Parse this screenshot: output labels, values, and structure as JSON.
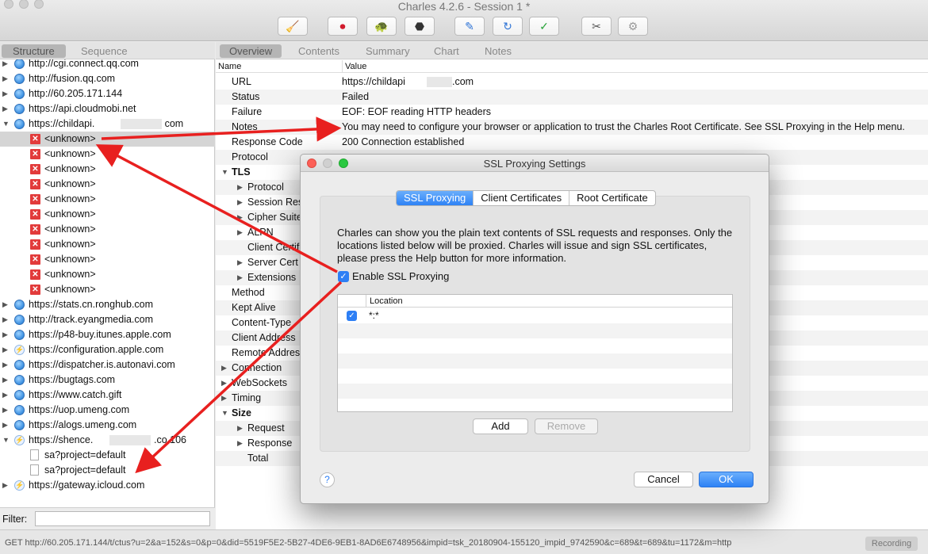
{
  "window": {
    "title": "Charles 4.2.6 - Session 1 *"
  },
  "toolbar": {
    "buttons": [
      {
        "name": "broom",
        "glyph": "🧹"
      },
      {
        "name": "record",
        "glyph": "⏺"
      },
      {
        "name": "throttle",
        "glyph": "🐢"
      },
      {
        "name": "breakpoints",
        "glyph": "⬣"
      },
      {
        "name": "compose",
        "glyph": "✎"
      },
      {
        "name": "repeat",
        "glyph": "↻"
      },
      {
        "name": "validate",
        "glyph": "✓"
      },
      {
        "name": "tools",
        "glyph": "✂"
      },
      {
        "name": "settings",
        "glyph": "⚙"
      }
    ]
  },
  "left": {
    "view_tabs": [
      "Structure",
      "Sequence"
    ],
    "tree": [
      {
        "label": "http://cgi.connect.qq.com",
        "icon": "globe",
        "indent": 0,
        "twisty": "▶"
      },
      {
        "label": "http://fusion.qq.com",
        "icon": "globe",
        "indent": 0,
        "twisty": "▶"
      },
      {
        "label": "http://60.205.171.144",
        "icon": "globe",
        "indent": 0,
        "twisty": "▶"
      },
      {
        "label": "https://api.cloudmobi.net",
        "icon": "globe",
        "indent": 0,
        "twisty": "▶"
      },
      {
        "label": "https://childapi.",
        "label2": "com",
        "icon": "globe",
        "indent": 0,
        "twisty": "▼"
      },
      {
        "label": "<unknown>",
        "icon": "error",
        "indent": 1,
        "selected": true
      },
      {
        "label": "<unknown>",
        "icon": "error",
        "indent": 1
      },
      {
        "label": "<unknown>",
        "icon": "error",
        "indent": 1
      },
      {
        "label": "<unknown>",
        "icon": "error",
        "indent": 1
      },
      {
        "label": "<unknown>",
        "icon": "error",
        "indent": 1
      },
      {
        "label": "<unknown>",
        "icon": "error",
        "indent": 1
      },
      {
        "label": "<unknown>",
        "icon": "error",
        "indent": 1
      },
      {
        "label": "<unknown>",
        "icon": "error",
        "indent": 1
      },
      {
        "label": "<unknown>",
        "icon": "error",
        "indent": 1
      },
      {
        "label": "<unknown>",
        "icon": "error",
        "indent": 1
      },
      {
        "label": "<unknown>",
        "icon": "error",
        "indent": 1
      },
      {
        "label": "https://stats.cn.ronghub.com",
        "icon": "globe",
        "indent": 0,
        "twisty": "▶"
      },
      {
        "label": "http://track.eyangmedia.com",
        "icon": "globe",
        "indent": 0,
        "twisty": "▶"
      },
      {
        "label": "https://p48-buy.itunes.apple.com",
        "icon": "globe",
        "indent": 0,
        "twisty": "▶"
      },
      {
        "label": "https://configuration.apple.com",
        "icon": "bolt",
        "indent": 0,
        "twisty": "▶"
      },
      {
        "label": "https://dispatcher.is.autonavi.com",
        "icon": "globe",
        "indent": 0,
        "twisty": "▶"
      },
      {
        "label": "https://bugtags.com",
        "icon": "globe",
        "indent": 0,
        "twisty": "▶"
      },
      {
        "label": "https://www.catch.gift",
        "icon": "globe",
        "indent": 0,
        "twisty": "▶"
      },
      {
        "label": "https://uop.umeng.com",
        "icon": "globe",
        "indent": 0,
        "twisty": "▶"
      },
      {
        "label": "https://alogs.umeng.com",
        "icon": "globe",
        "indent": 0,
        "twisty": "▶"
      },
      {
        "label": "https://shence.",
        "label2": ".co  106",
        "icon": "bolt",
        "indent": 0,
        "twisty": "▼"
      },
      {
        "label": "sa?project=default",
        "icon": "doc",
        "indent": 1
      },
      {
        "label": "sa?project=default",
        "icon": "doc",
        "indent": 1
      },
      {
        "label": "https://gateway.icloud.com",
        "icon": "bolt",
        "indent": 0,
        "twisty": "▶"
      }
    ],
    "filter_label": "Filter:"
  },
  "right": {
    "tabs": [
      "Overview",
      "Contents",
      "Summary",
      "Chart",
      "Notes"
    ],
    "col_name": "Name",
    "col_value": "Value",
    "rows": [
      {
        "name": "URL",
        "value": "https://childapi",
        "value2": ".com",
        "indent": 0
      },
      {
        "name": "Status",
        "value": "Failed",
        "indent": 0
      },
      {
        "name": "Failure",
        "value": "EOF: EOF reading HTTP headers",
        "indent": 0
      },
      {
        "name": "Notes",
        "value": "You may need to configure your browser or application to trust the Charles Root Certificate. See SSL Proxying in the Help menu.",
        "indent": 0
      },
      {
        "name": "Response Code",
        "value": "200 Connection established",
        "indent": 0
      },
      {
        "name": "Protocol",
        "value": "",
        "indent": 0
      },
      {
        "name": "TLS",
        "value": "",
        "indent": -1,
        "twisty": "▼",
        "bold": true
      },
      {
        "name": "Protocol",
        "value": "",
        "indent": 1,
        "twisty": "▶"
      },
      {
        "name": "Session Res",
        "value": "",
        "indent": 1,
        "twisty": "▶"
      },
      {
        "name": "Cipher Suite",
        "value": "",
        "indent": 1,
        "twisty": "▶"
      },
      {
        "name": "ALPN",
        "value": "",
        "indent": 1,
        "twisty": "▶"
      },
      {
        "name": "Client Certifi",
        "value": "",
        "indent": 1
      },
      {
        "name": "Server Cert",
        "value": "",
        "indent": 1,
        "twisty": "▶"
      },
      {
        "name": "Extensions",
        "value": "",
        "indent": 1,
        "twisty": "▶"
      },
      {
        "name": "Method",
        "value": "",
        "indent": 0
      },
      {
        "name": "Kept Alive",
        "value": "",
        "indent": 0
      },
      {
        "name": "Content-Type",
        "value": "",
        "indent": 0
      },
      {
        "name": "Client Address",
        "value": "",
        "indent": 0
      },
      {
        "name": "Remote Address",
        "value": "",
        "indent": 0
      },
      {
        "name": "Connection",
        "value": "",
        "indent": -1,
        "twisty": "▶"
      },
      {
        "name": "WebSockets",
        "value": "",
        "indent": -1,
        "twisty": "▶"
      },
      {
        "name": "Timing",
        "value": "",
        "indent": -1,
        "twisty": "▶"
      },
      {
        "name": "Size",
        "value": "",
        "indent": -1,
        "twisty": "▼",
        "bold": true
      },
      {
        "name": "Request",
        "value": "",
        "indent": 1,
        "twisty": "▶"
      },
      {
        "name": "Response",
        "value": "",
        "indent": 1,
        "twisty": "▶"
      },
      {
        "name": "Total",
        "value": "",
        "indent": 1
      }
    ]
  },
  "status_bar": {
    "text": "GET http://60.205.171.144/t/ctus?u=2&a=152&s=0&p=0&did=5519F5E2-5B27-4DE6-9EB1-8AD6E6748956&impid=tsk_20180904-155120_impid_9742590&c=689&t=689&tu=1172&m=http",
    "recording": "Recording"
  },
  "dialog": {
    "title": "SSL Proxying Settings",
    "tabs": [
      "SSL Proxying",
      "Client Certificates",
      "Root Certificate"
    ],
    "description": "Charles can show you the plain text contents of SSL requests and responses. Only the locations listed below will be proxied. Charles will issue and sign SSL certificates, please press the Help button for more information.",
    "enable_label": "Enable SSL Proxying",
    "enable_checked": true,
    "table_header": "Location",
    "locations": [
      {
        "location": "*:*",
        "enabled": true
      }
    ],
    "add_label": "Add",
    "remove_label": "Remove",
    "help_label": "?",
    "cancel_label": "Cancel",
    "ok_label": "OK"
  },
  "colors": {
    "accent": "#2d7ff5",
    "arrow": "#e8201f",
    "error": "#e23b3b"
  }
}
